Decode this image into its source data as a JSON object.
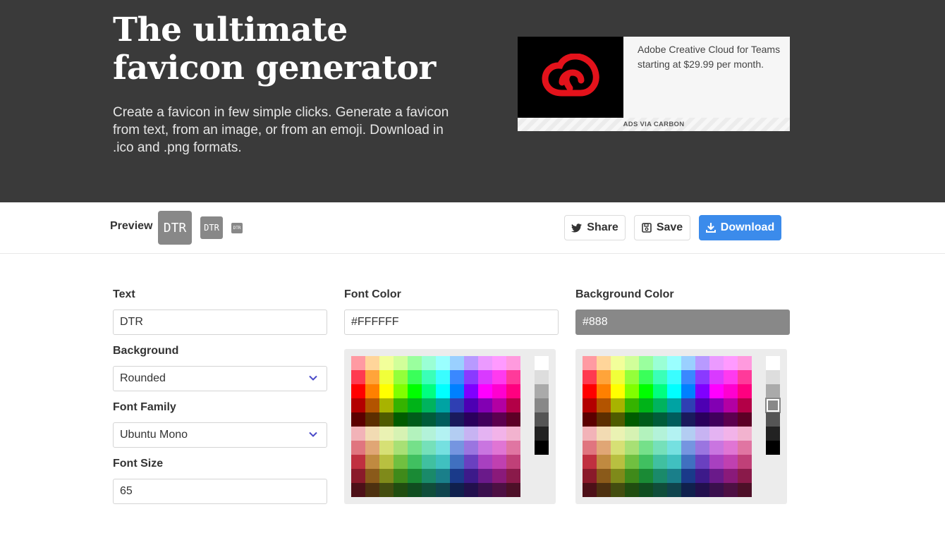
{
  "hero": {
    "title": "The ultimate favicon generator",
    "subtitle": "Create a favicon in few simple clicks. Generate a favicon from text, from an image, or from an emoji. Download in .ico and .png formats."
  },
  "ad": {
    "text": "Adobe Creative Cloud for Teams starting at $29.99 per month.",
    "footer": "ADS VIA CARBON",
    "logo_icon": "adobe-creative-cloud-logo",
    "logo_color": "#e3121b"
  },
  "preview": {
    "label": "Preview",
    "favicon_text": "DTR",
    "share_label": "Share",
    "save_label": "Save",
    "download_label": "Download",
    "share_icon": "twitter-icon",
    "save_icon": "floppy-disk-icon",
    "download_icon": "download-icon",
    "accent": "#3b8beb"
  },
  "form": {
    "text_label": "Text",
    "text_value": "DTR",
    "background_label": "Background",
    "background_value": "Rounded",
    "font_family_label": "Font Family",
    "font_family_value": "Ubuntu Mono",
    "font_size_label": "Font Size",
    "font_size_value": "65",
    "font_color_label": "Font Color",
    "font_color_value": "#FFFFFF",
    "bg_color_label": "Background Color",
    "bg_color_value": "#888"
  },
  "palette": {
    "rows": [
      [
        "#ff9aa2",
        "#ffd59a",
        "#f2ff9a",
        "#d1ff9a",
        "#9aff9e",
        "#9affd5",
        "#9affff",
        "#9ad0ff",
        "#b89aff",
        "#eb9aff",
        "#ff9aff",
        "#ff9ade"
      ],
      [
        "#ff3a50",
        "#ffa43a",
        "#f0ff3a",
        "#94ff3a",
        "#3aff5a",
        "#3affb8",
        "#3afdff",
        "#3a88ff",
        "#8a3aff",
        "#d93aff",
        "#ff3aef",
        "#ff3a9a"
      ],
      [
        "#ff0000",
        "#ff8000",
        "#ffff00",
        "#80ff00",
        "#00ff00",
        "#00ff80",
        "#00ffff",
        "#0080ff",
        "#8000ff",
        "#ff00ff",
        "#ff00d0",
        "#ff0080"
      ],
      [
        "#b30000",
        "#b35400",
        "#a8b300",
        "#35b300",
        "#00b318",
        "#00b35e",
        "#00a3a3",
        "#2f3fb3",
        "#4d00b3",
        "#8200b3",
        "#b300a3",
        "#b30047"
      ],
      [
        "#5c0000",
        "#5c2e00",
        "#4f5c00",
        "#005c00",
        "#005c1a",
        "#005c3a",
        "#005c5c",
        "#1a1a5c",
        "#2a005c",
        "#41005c",
        "#5c004f",
        "#5c0026"
      ],
      [
        "#f2b3b8",
        "#f2dbb3",
        "#eaf2b3",
        "#d6f2b3",
        "#b3f2bd",
        "#b3f2d9",
        "#b3f2f2",
        "#b3cdf2",
        "#c7b3f2",
        "#e4b3f2",
        "#f2b3e9",
        "#f2b3cf"
      ],
      [
        "#e0757f",
        "#e0a675",
        "#d6e075",
        "#a8e075",
        "#75e08a",
        "#75e0ba",
        "#75e0e0",
        "#7595e0",
        "#9a75e0",
        "#c975e0",
        "#e075d4",
        "#e075a2"
      ],
      [
        "#c03040",
        "#c08a40",
        "#b8c040",
        "#70c040",
        "#40c060",
        "#40c0a0",
        "#40c0c0",
        "#4070c0",
        "#6a40c0",
        "#a840c0",
        "#c040b0",
        "#c04078"
      ],
      [
        "#8a1a2a",
        "#8a5a1a",
        "#7f8a1a",
        "#3f8a1a",
        "#1a8a35",
        "#1a8a6a",
        "#1a7f8a",
        "#1a3a8a",
        "#3d1a8a",
        "#6a1a8a",
        "#8a1a7a",
        "#8a1a4a"
      ],
      [
        "#4d1018",
        "#4d3010",
        "#434d10",
        "#204d10",
        "#104d20",
        "#104d3a",
        "#10444d",
        "#10204d",
        "#22104d",
        "#3a104d",
        "#4d1043",
        "#4d1028"
      ]
    ],
    "grays": [
      "#ffffff",
      "#dddddd",
      "#aaaaaa",
      "#888888",
      "#555555",
      "#222222",
      "#000000"
    ],
    "selected_gray_index": 3
  }
}
